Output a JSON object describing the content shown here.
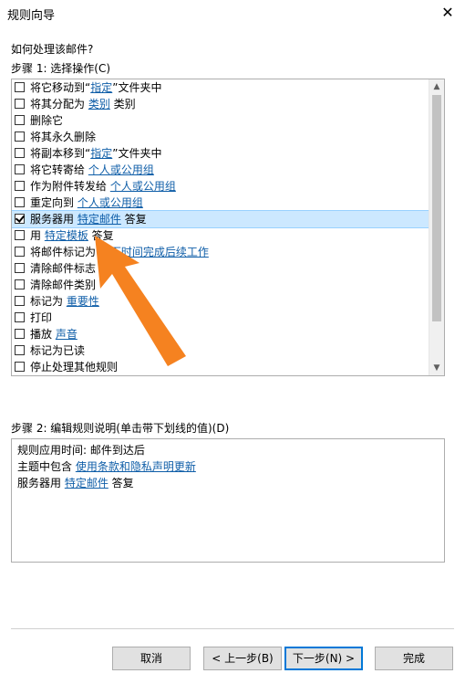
{
  "window": {
    "title": "规则向导",
    "close_icon": "✕"
  },
  "question": "如何处理该邮件?",
  "step1": {
    "label": "步骤 1: 选择操作(C)",
    "items": [
      {
        "checked": false,
        "selected": false,
        "segments": [
          {
            "text": "将它移动到“"
          },
          {
            "text": "指定",
            "link": true
          },
          {
            "text": "”文件夹中"
          }
        ]
      },
      {
        "checked": false,
        "selected": false,
        "segments": [
          {
            "text": "将其分配为 "
          },
          {
            "text": "类别",
            "link": true
          },
          {
            "text": " 类别"
          }
        ]
      },
      {
        "checked": false,
        "selected": false,
        "segments": [
          {
            "text": "删除它"
          }
        ]
      },
      {
        "checked": false,
        "selected": false,
        "segments": [
          {
            "text": "将其永久删除"
          }
        ]
      },
      {
        "checked": false,
        "selected": false,
        "segments": [
          {
            "text": "将副本移到“"
          },
          {
            "text": "指定",
            "link": true
          },
          {
            "text": "”文件夹中"
          }
        ]
      },
      {
        "checked": false,
        "selected": false,
        "segments": [
          {
            "text": "将它转寄给 "
          },
          {
            "text": "个人或公用组",
            "link": true
          }
        ]
      },
      {
        "checked": false,
        "selected": false,
        "segments": [
          {
            "text": "作为附件转发给 "
          },
          {
            "text": "个人或公用组",
            "link": true
          }
        ]
      },
      {
        "checked": false,
        "selected": false,
        "segments": [
          {
            "text": "重定向到 "
          },
          {
            "text": "个人或公用组",
            "link": true
          }
        ]
      },
      {
        "checked": true,
        "selected": true,
        "segments": [
          {
            "text": "服务器用 "
          },
          {
            "text": "特定邮件",
            "link": true
          },
          {
            "text": " 答复"
          }
        ]
      },
      {
        "checked": false,
        "selected": false,
        "segments": [
          {
            "text": "用 "
          },
          {
            "text": "特定模板",
            "link": true
          },
          {
            "text": " 答复"
          }
        ]
      },
      {
        "checked": false,
        "selected": false,
        "segments": [
          {
            "text": "将邮件标记为 "
          },
          {
            "text": "在下时间完成后续工作",
            "link": true
          }
        ]
      },
      {
        "checked": false,
        "selected": false,
        "segments": [
          {
            "text": "清除邮件标志"
          }
        ]
      },
      {
        "checked": false,
        "selected": false,
        "segments": [
          {
            "text": "清除邮件类别"
          }
        ]
      },
      {
        "checked": false,
        "selected": false,
        "segments": [
          {
            "text": "标记为 "
          },
          {
            "text": "重要性",
            "link": true
          }
        ]
      },
      {
        "checked": false,
        "selected": false,
        "segments": [
          {
            "text": "打印"
          }
        ]
      },
      {
        "checked": false,
        "selected": false,
        "segments": [
          {
            "text": "播放 "
          },
          {
            "text": "声音",
            "link": true
          }
        ]
      },
      {
        "checked": false,
        "selected": false,
        "segments": [
          {
            "text": "标记为已读"
          }
        ]
      },
      {
        "checked": false,
        "selected": false,
        "segments": [
          {
            "text": "停止处理其他规则"
          }
        ]
      }
    ],
    "scroll_up_icon": "▲",
    "scroll_down_icon": "▼"
  },
  "step2": {
    "label": "步骤 2: 编辑规则说明(单击带下划线的值)(D)",
    "lines": [
      [
        {
          "text": "规则应用时间: 邮件到达后"
        }
      ],
      [
        {
          "text": "主题中包含 "
        },
        {
          "text": "使用条款和隐私声明更新",
          "link": true
        }
      ],
      [
        {
          "text": "服务器用 "
        },
        {
          "text": "特定邮件",
          "link": true
        },
        {
          "text": " 答复"
        }
      ]
    ]
  },
  "buttons": {
    "cancel": "取消",
    "back": "< 上一步(B)",
    "next": "下一步(N) >",
    "finish": "完成"
  },
  "colors": {
    "link": "#0f5ea8",
    "selection": "#cce8ff",
    "annotation_arrow": "#f58220"
  }
}
